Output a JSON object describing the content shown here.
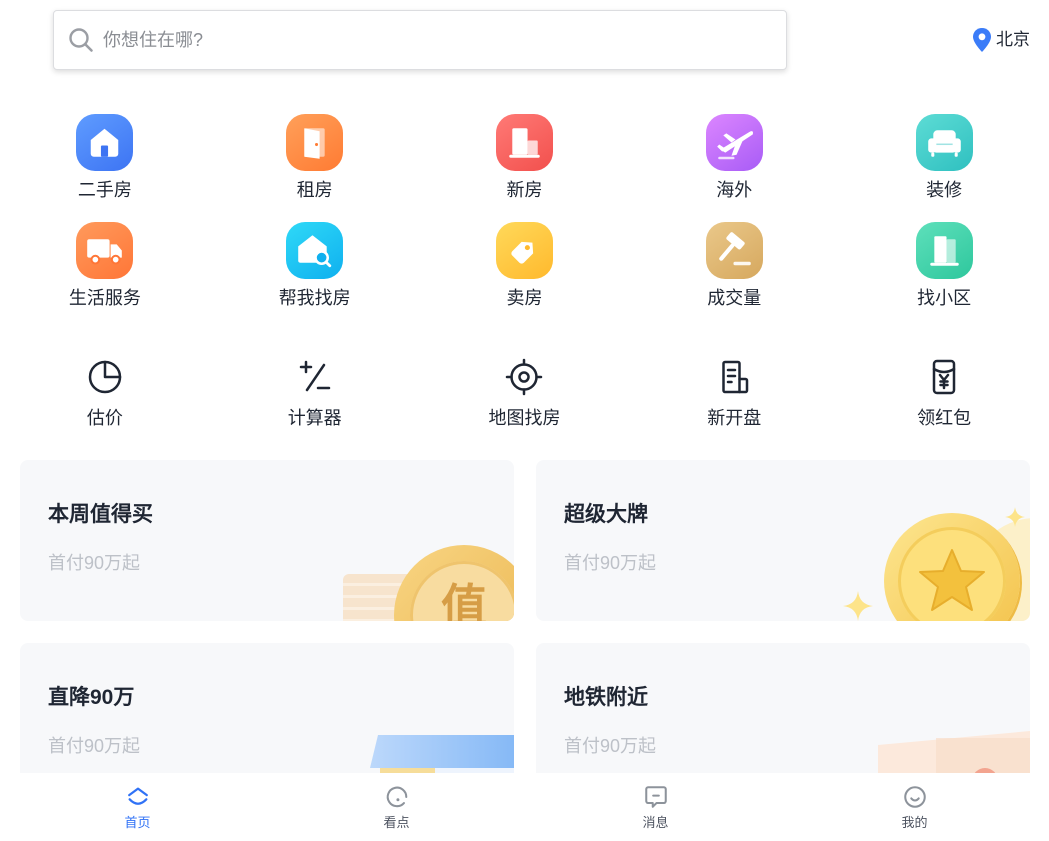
{
  "search": {
    "placeholder": "你想住在哪?",
    "icon": "search-icon"
  },
  "location": {
    "city": "北京",
    "icon": "location-pin-icon"
  },
  "primary_entries": [
    {
      "label": "二手房",
      "icon": "house-icon",
      "color_from": "#5f9cff",
      "color_to": "#3d74f3"
    },
    {
      "label": "租房",
      "icon": "door-icon",
      "color_from": "#ffa05a",
      "color_to": "#ff7b33"
    },
    {
      "label": "新房",
      "icon": "building-icon",
      "color_from": "#ff7a76",
      "color_to": "#f2504d"
    },
    {
      "label": "海外",
      "icon": "airplane-icon",
      "color_from": "#dc86ff",
      "color_to": "#a85cf6"
    },
    {
      "label": "装修",
      "icon": "sofa-icon",
      "color_from": "#5ddcd5",
      "color_to": "#2fc0c0"
    },
    {
      "label": "生活服务",
      "icon": "truck-icon",
      "color_from": "#ff9a5c",
      "color_to": "#ff7637"
    },
    {
      "label": "帮我找房",
      "icon": "house-search-icon",
      "color_from": "#2fd9f7",
      "color_to": "#0fb0ef"
    },
    {
      "label": "卖房",
      "icon": "price-tag-icon",
      "color_from": "#ffd95a",
      "color_to": "#ffb92d"
    },
    {
      "label": "成交量",
      "icon": "gavel-icon",
      "color_from": "#eac88a",
      "color_to": "#d6a85e"
    },
    {
      "label": "找小区",
      "icon": "community-door-icon",
      "color_from": "#5ee0bb",
      "color_to": "#2ec79d"
    }
  ],
  "tool_entries": [
    {
      "label": "估价",
      "icon": "pie-chart-icon"
    },
    {
      "label": "计算器",
      "icon": "plus-minus-icon"
    },
    {
      "label": "地图找房",
      "icon": "target-icon"
    },
    {
      "label": "新开盘",
      "icon": "document-icon"
    },
    {
      "label": "领红包",
      "icon": "red-packet-icon"
    }
  ],
  "cards": [
    {
      "title": "本周值得买",
      "subtitle": "首付90万起",
      "badge": "值"
    },
    {
      "title": "超级大牌",
      "subtitle": "首付90万起"
    },
    {
      "title": "直降90万",
      "subtitle": "首付90万起"
    },
    {
      "title": "地铁附近",
      "subtitle": "首付90万起"
    }
  ],
  "tabbar": [
    {
      "label": "首页",
      "icon": "home-icon",
      "active": true
    },
    {
      "label": "看点",
      "icon": "discover-icon",
      "active": false
    },
    {
      "label": "消息",
      "icon": "message-icon",
      "active": false
    },
    {
      "label": "我的",
      "icon": "profile-icon",
      "active": false
    }
  ],
  "colors": {
    "accent": "#3072f6",
    "pin": "#3b7cf8",
    "text": "#1f2633",
    "muted": "#bdc1c8",
    "card_bg": "#f7f8fa",
    "icon_muted": "#8d939b"
  }
}
